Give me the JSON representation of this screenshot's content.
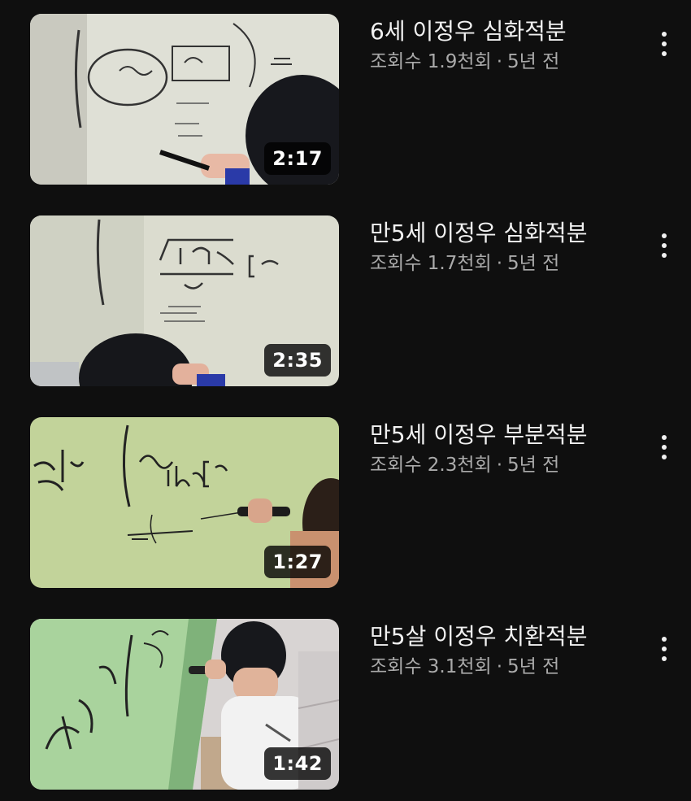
{
  "videos": [
    {
      "title": "6세 이정우 심화적분",
      "views": "조회수 1.9천회",
      "age": "5년 전",
      "duration": "2:17"
    },
    {
      "title": "만5세 이정우 심화적분",
      "views": "조회수 1.7천회",
      "age": "5년 전",
      "duration": "2:35"
    },
    {
      "title": "만5세 이정우 부분적분",
      "views": "조회수 2.3천회",
      "age": "5년 전",
      "duration": "1:27"
    },
    {
      "title": "만5살 이정우 치환적분",
      "views": "조회수 3.1천회",
      "age": "5년 전",
      "duration": "1:42"
    }
  ],
  "separator": "·",
  "icons": {
    "menu": "more-vertical-icon"
  }
}
